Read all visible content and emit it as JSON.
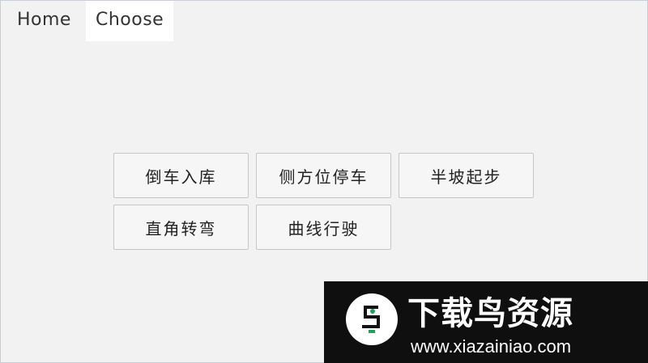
{
  "tabs": [
    {
      "label": "Home"
    },
    {
      "label": "Choose"
    }
  ],
  "buttons": [
    {
      "label": "倒车入库"
    },
    {
      "label": "侧方位停车"
    },
    {
      "label": "半坡起步"
    },
    {
      "label": "直角转弯"
    },
    {
      "label": "曲线行驶"
    }
  ],
  "watermark": {
    "title": "下载鸟资源",
    "url": "www.xiazainiao.com"
  },
  "colors": {
    "background": "#f2f2f2",
    "active_tab": "#ffffff",
    "watermark_bg": "#0f0f0f",
    "logo_accent": "#1fa35b"
  }
}
